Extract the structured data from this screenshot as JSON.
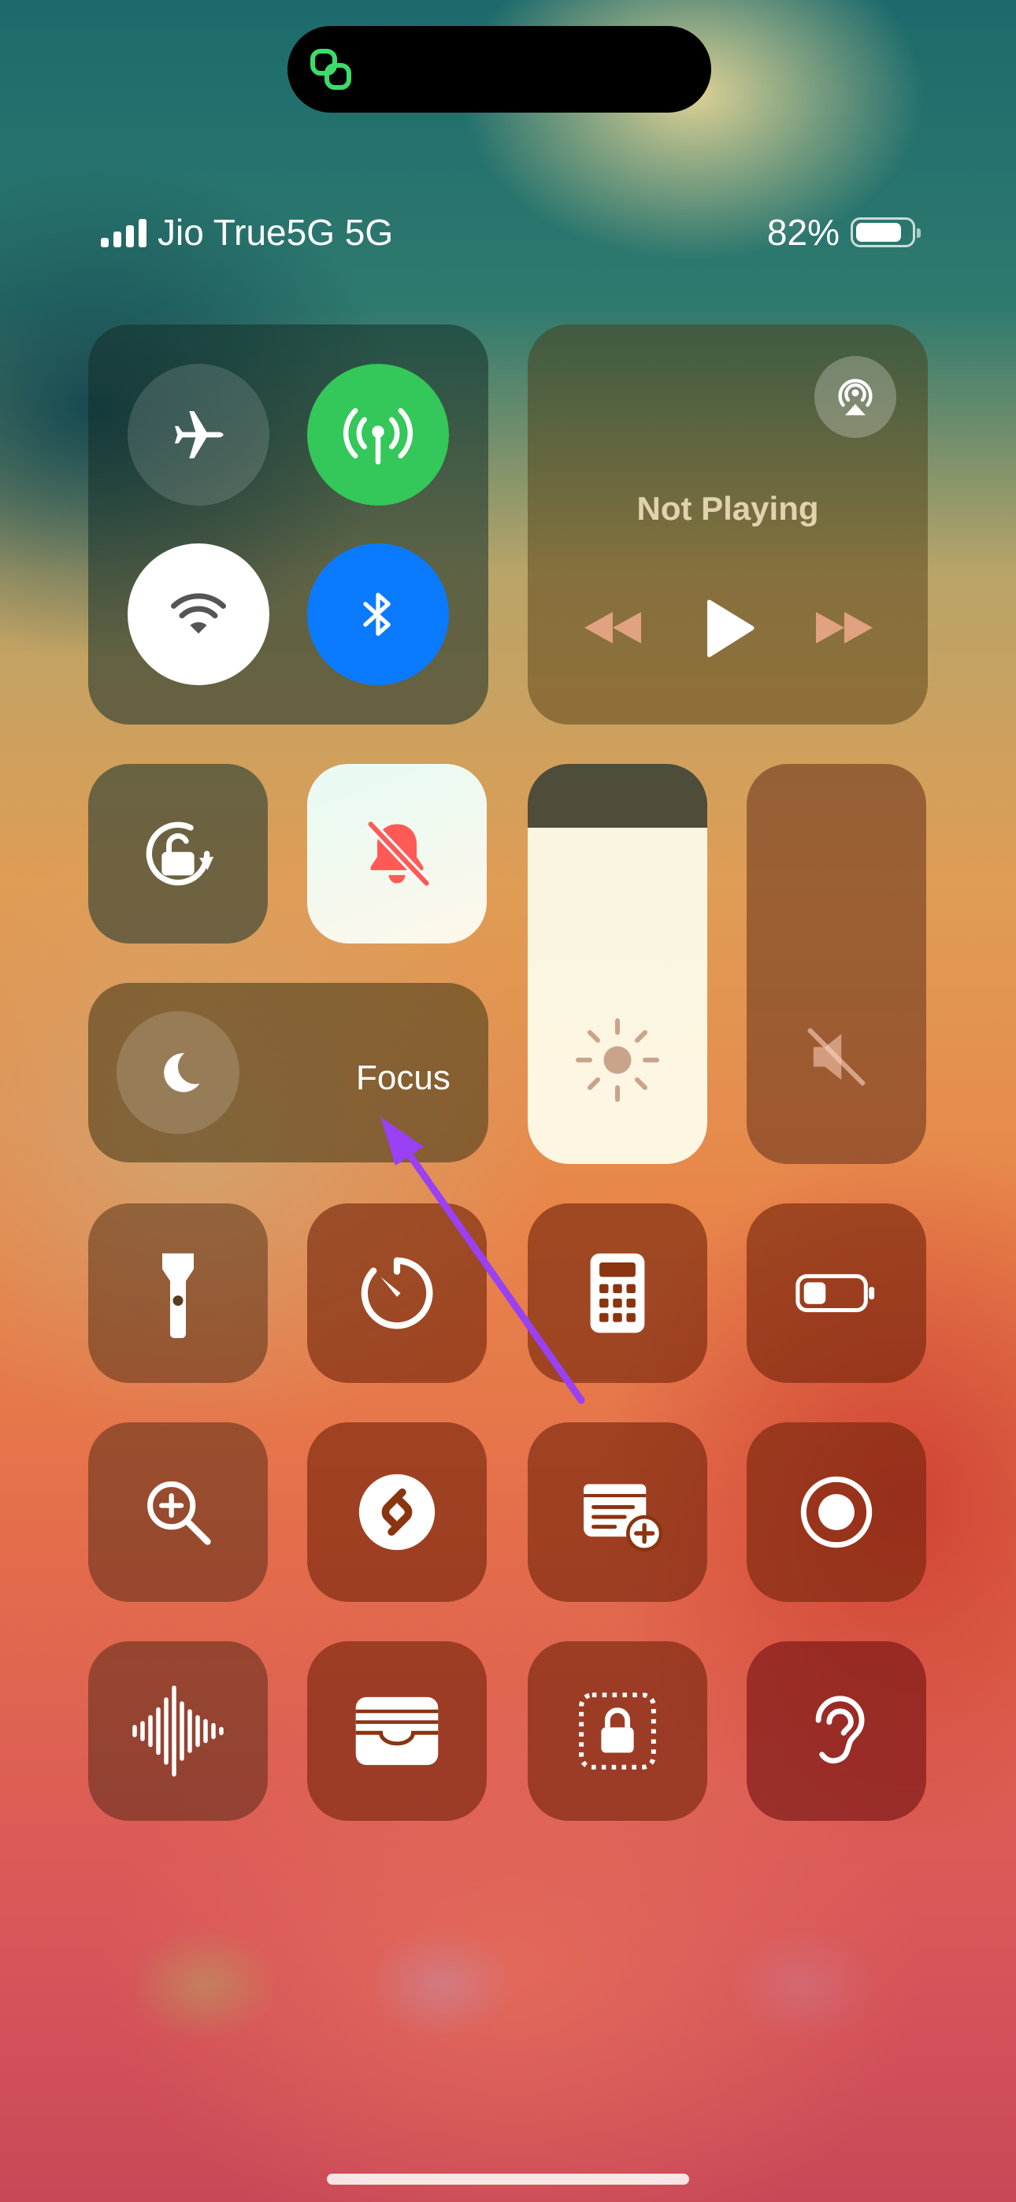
{
  "status_bar": {
    "carrier": "Jio True5G 5G",
    "battery_percent_text": "82%",
    "battery_level": 0.82,
    "signal_bars": 4
  },
  "connectivity": {
    "airplane": {
      "icon": "airplane-icon",
      "state": "off"
    },
    "cellular_data": {
      "icon": "antenna-icon",
      "state": "on",
      "color": "#34c759"
    },
    "wifi": {
      "icon": "wifi-icon",
      "state": "on"
    },
    "bluetooth": {
      "icon": "bluetooth-icon",
      "state": "on",
      "color": "#0a7aff"
    }
  },
  "now_playing": {
    "title": "Not Playing",
    "airplay_icon": "airplay-icon",
    "controls": [
      "rewind-icon",
      "play-icon",
      "fast-forward-icon"
    ]
  },
  "toggles": {
    "orientation_lock": {
      "icon": "rotation-lock-icon"
    },
    "silent_mode": {
      "icon": "bell-slash-icon",
      "accent": "#ff5a55"
    }
  },
  "focus": {
    "label": "Focus",
    "icon": "moon-icon"
  },
  "sliders": {
    "brightness": {
      "level": 0.84,
      "icon": "sun-icon"
    },
    "volume": {
      "level": 0.0,
      "icon": "speaker-muted-icon"
    }
  },
  "controls_grid": [
    [
      "flashlight-icon",
      "timer-icon",
      "calculator-icon",
      "low-power-mode-icon"
    ],
    [
      "magnifier-icon",
      "shazam-icon",
      "quick-note-icon",
      "screen-recording-icon"
    ],
    [
      "sound-recognition-icon",
      "wallet-icon",
      "guided-access-icon",
      "hearing-icon"
    ]
  ],
  "annotation": {
    "arrow_color": "#9a40f5"
  }
}
